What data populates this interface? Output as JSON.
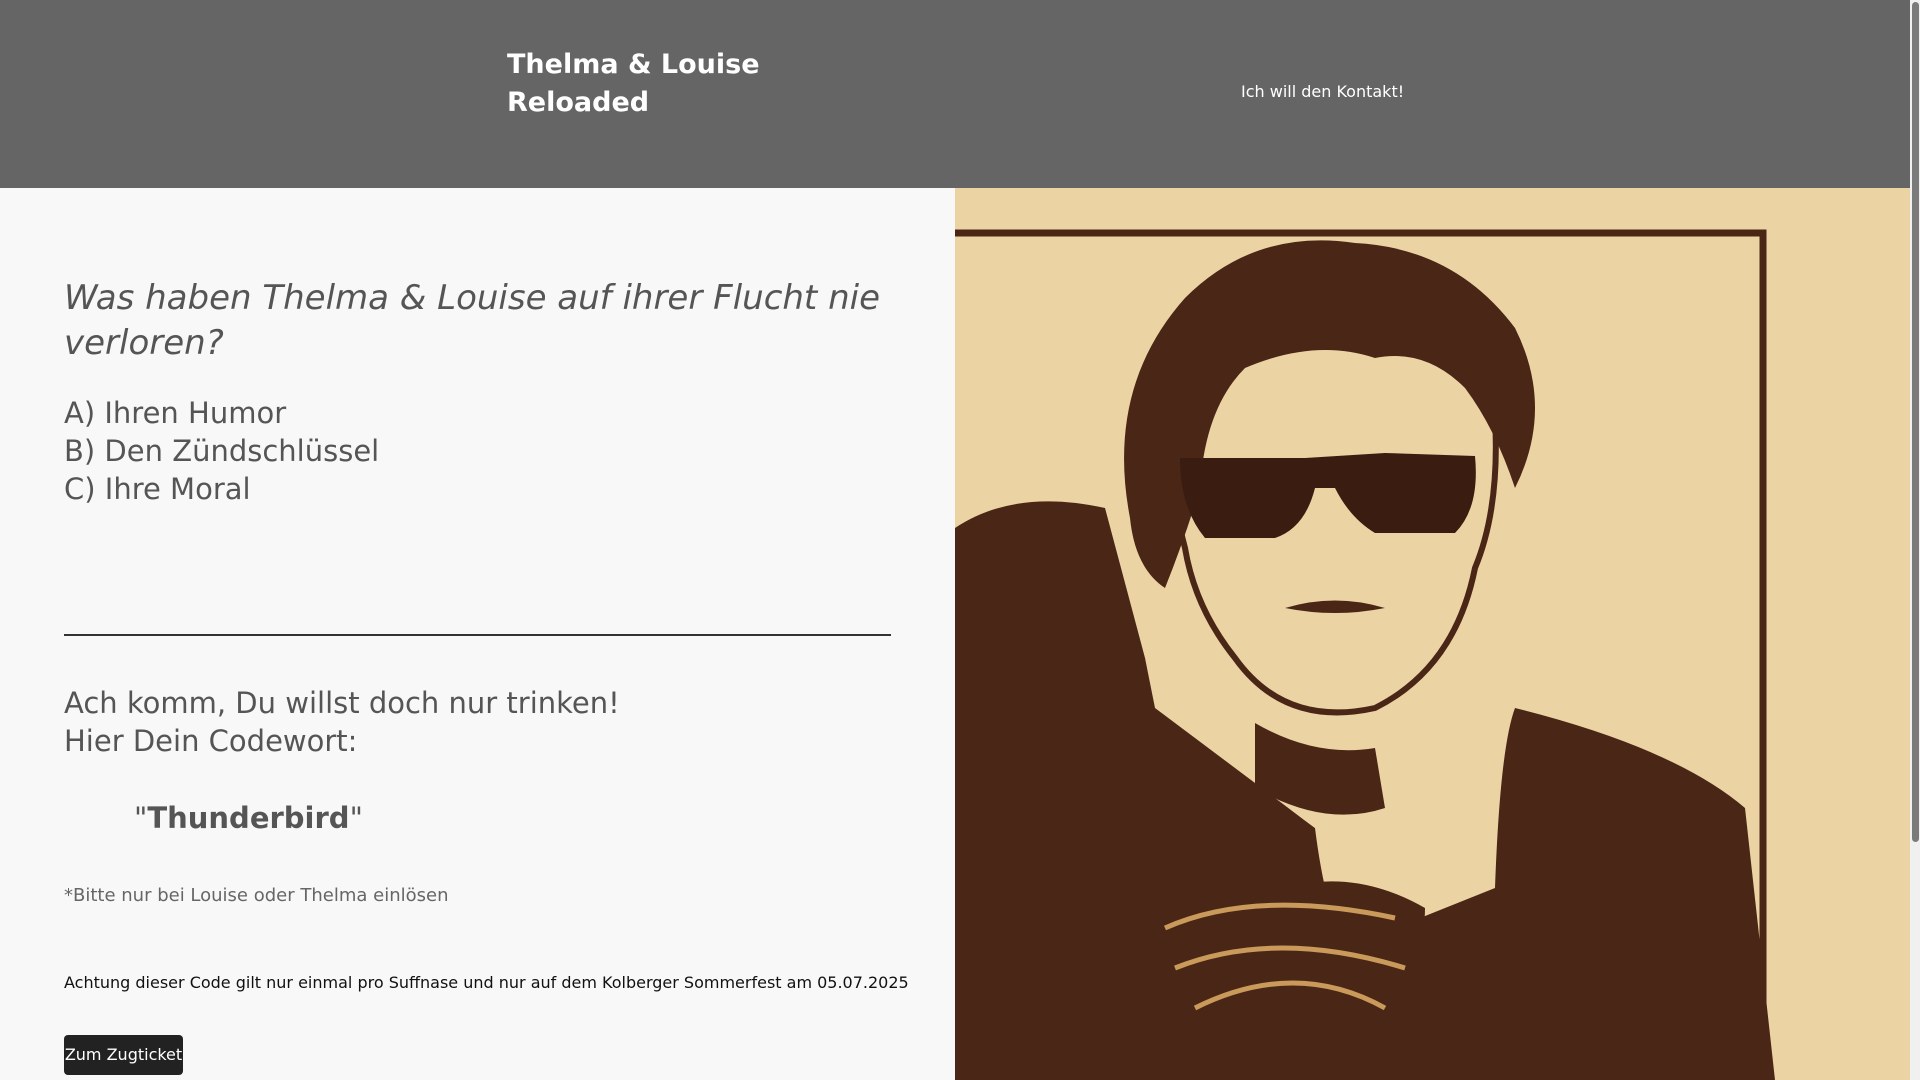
{
  "header": {
    "title_line1": "Thelma & Louise",
    "title_line2": "Reloaded",
    "contact_link": "Ich will den Kontakt!"
  },
  "quiz": {
    "question": "Was haben Thelma & Louise auf ihrer Flucht nie verloren?",
    "answers": [
      "A) Ihren Humor",
      "B) Den Zündschlüssel",
      "C) Ihre Moral"
    ]
  },
  "reward": {
    "line1": "Ach komm, Du willst doch nur trinken!",
    "line2": "Hier Dein Codewort:",
    "quote_open": "\"",
    "codeword": "Thunderbird",
    "quote_close": "\"",
    "hint": "*Bitte nur bei Louise oder Thelma einlösen",
    "warning": "Achtung dieser Code gilt nur einmal pro Suffnase und nur auf dem Kolberger Sommerfest am 05.07.2025",
    "button": "Zum Zugticket"
  },
  "colors": {
    "header_bg": "#656565",
    "page_bg": "#f8f8f8",
    "poster_bg": "#ecd3a4",
    "poster_ink": "#4a2616",
    "button_bg": "#222222"
  }
}
